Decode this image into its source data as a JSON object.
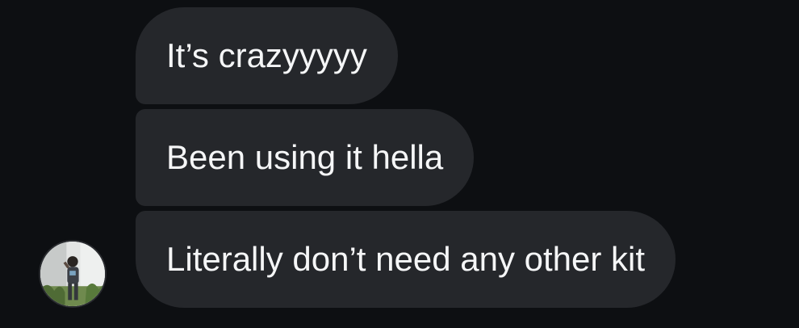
{
  "messages": [
    {
      "text": "It’s crazyyyyy"
    },
    {
      "text": "Been using it hella"
    },
    {
      "text": "Literally don’t need any other kit"
    }
  ],
  "colors": {
    "background": "#0d0f12",
    "bubble": "#25272b",
    "text": "#f5f6f7"
  },
  "icons": {
    "avatar": "sender-avatar-photo"
  }
}
